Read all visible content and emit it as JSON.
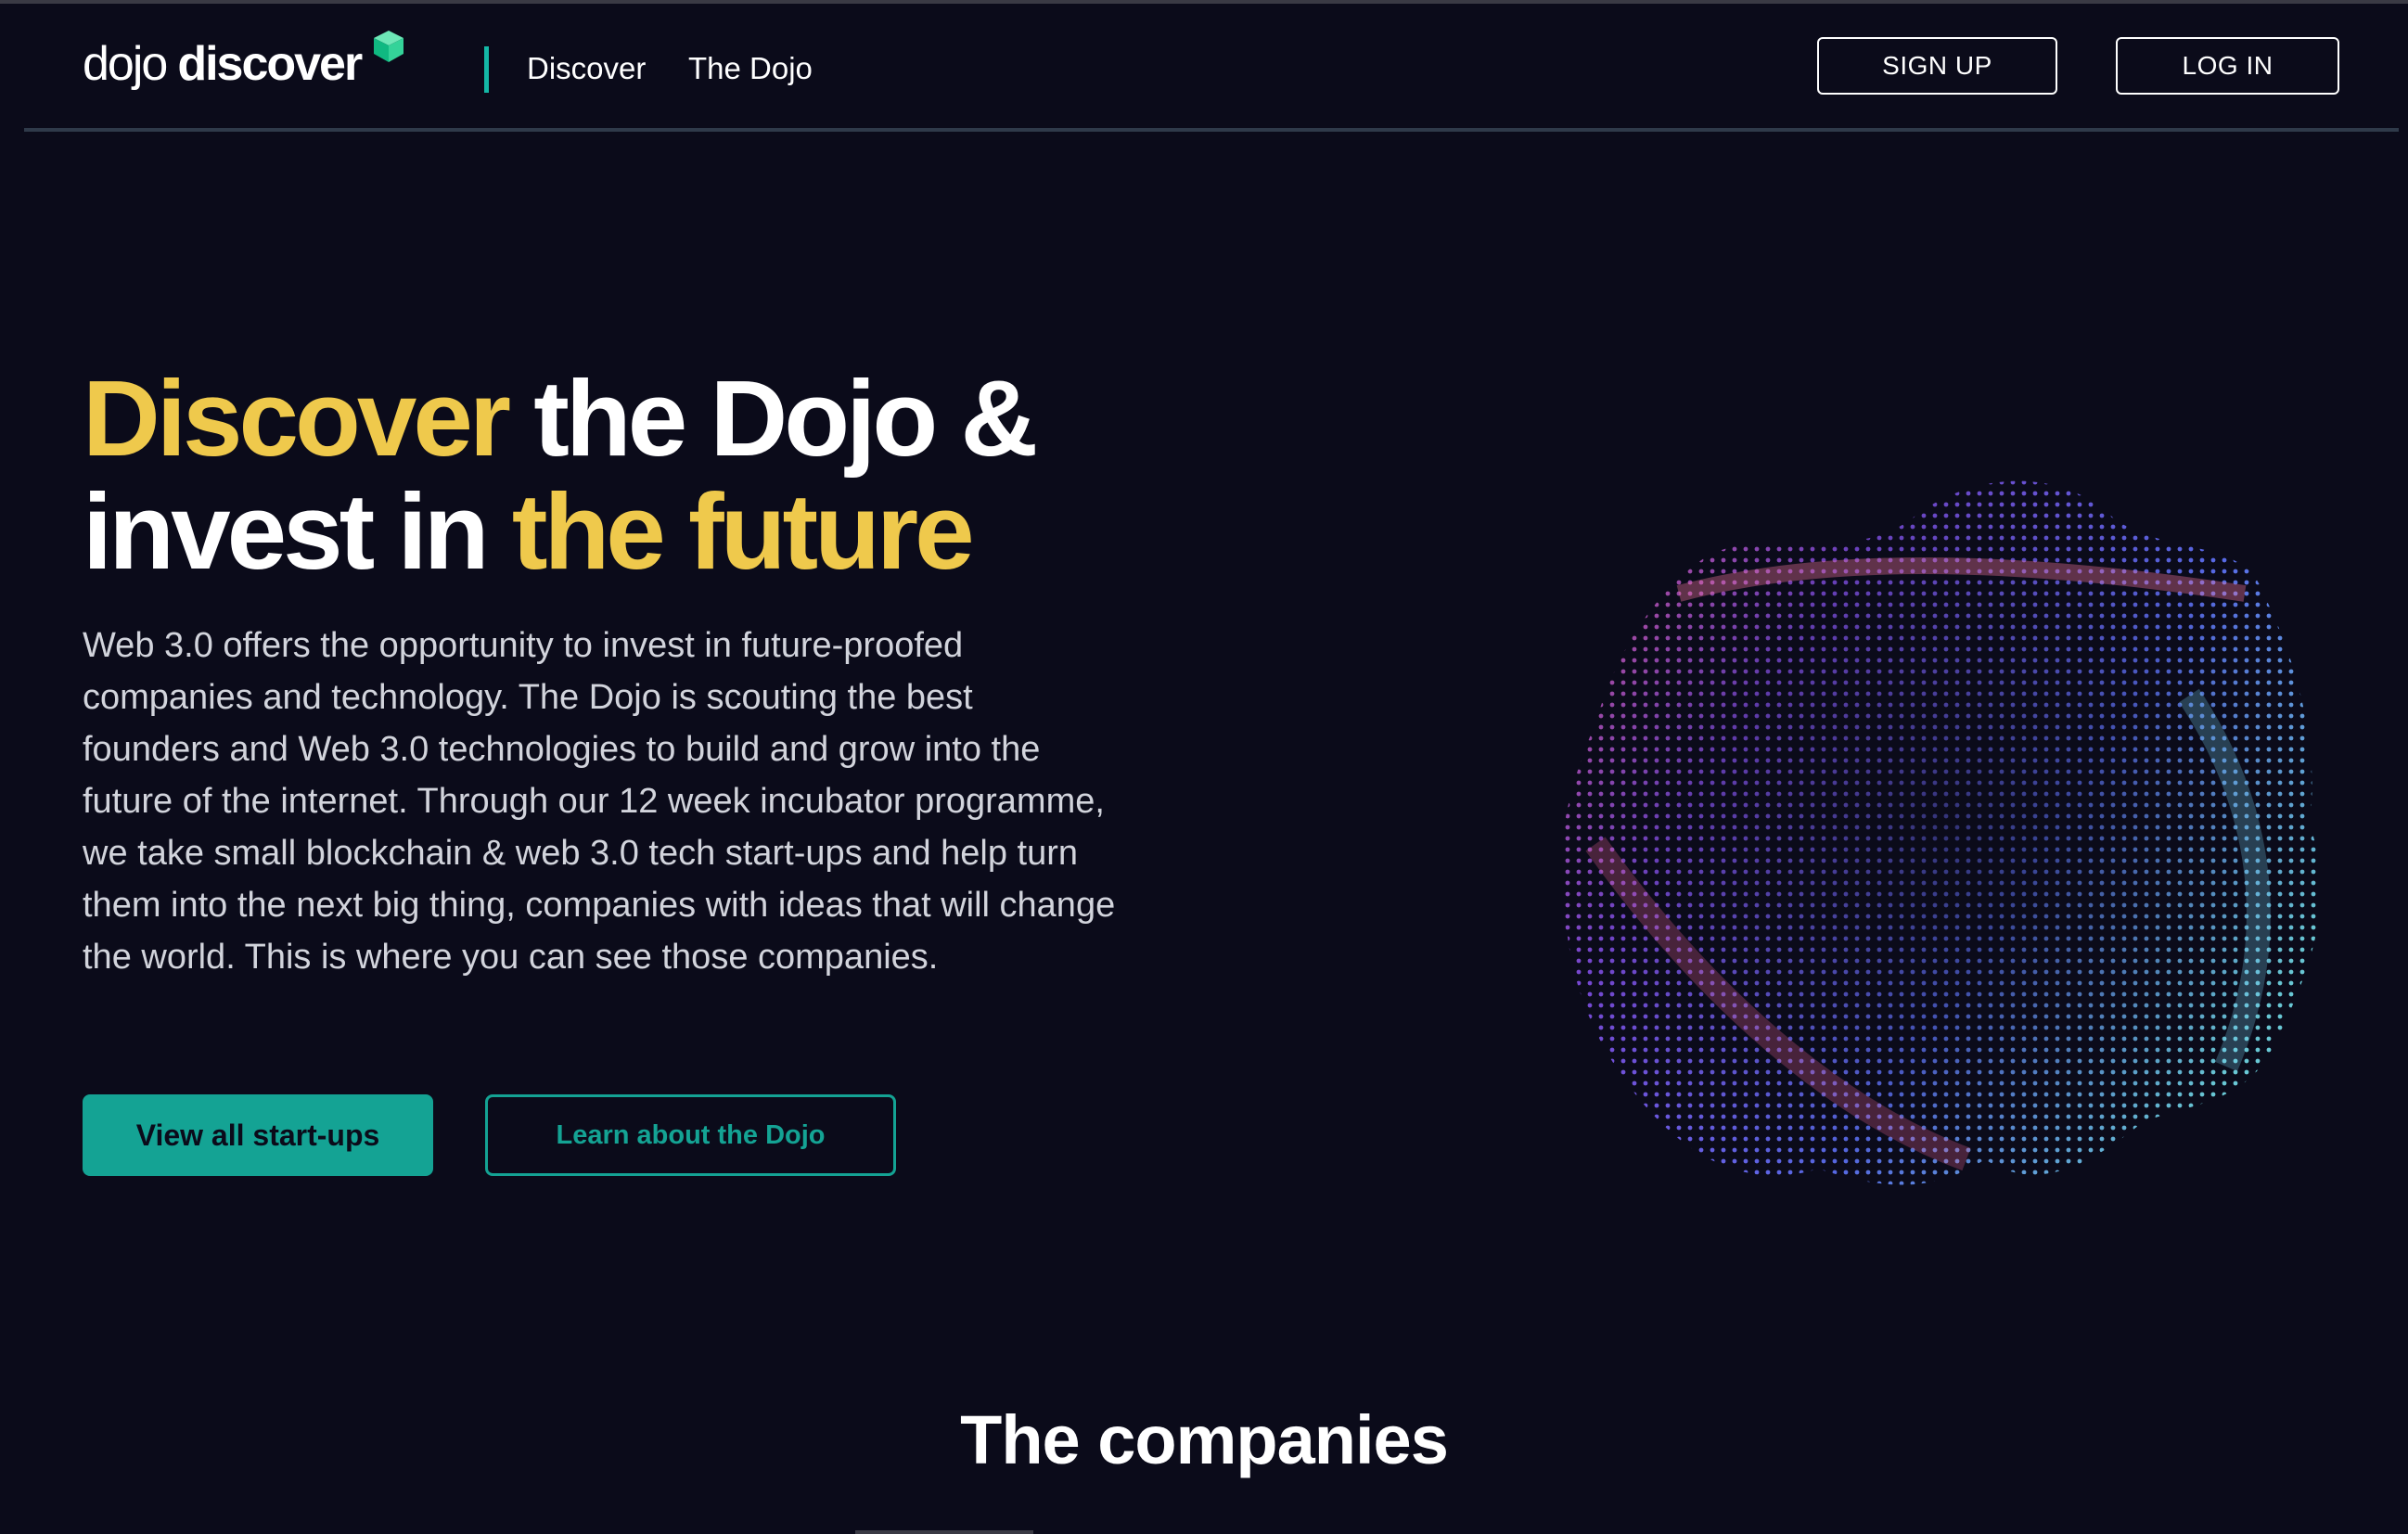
{
  "header": {
    "logo": {
      "word_light": "dojo",
      "word_bold": "discover"
    },
    "nav": [
      {
        "label": "Discover"
      },
      {
        "label": "The Dojo"
      }
    ],
    "signup_label": "SIGN UP",
    "login_label": "LOG IN"
  },
  "hero": {
    "title_part1": "Discover",
    "title_part2": " the Dojo &",
    "title_part3": "invest in ",
    "title_part4": "the future",
    "description": "Web 3.0 offers the opportunity to invest in future-proofed companies and technology. The Dojo is scouting the best founders and Web 3.0 technologies to build and grow into the future of the internet. Through our 12 week incubator programme, we take small blockchain & web 3.0 tech start-ups and help turn them into the next big thing, companies with ideas that will change the world. This is where you can see those companies.",
    "primary_button": "View all start-ups",
    "secondary_button": "Learn about the Dojo"
  },
  "companies": {
    "title": "The companies"
  },
  "colors": {
    "background": "#0b0b1a",
    "accent_yellow": "#efc94c",
    "accent_teal": "#14a394",
    "text_muted": "#d2d4dc"
  },
  "icons": {
    "logo_mark": "green-cube-icon",
    "hero_visual": "particle-sphere-graphic"
  }
}
